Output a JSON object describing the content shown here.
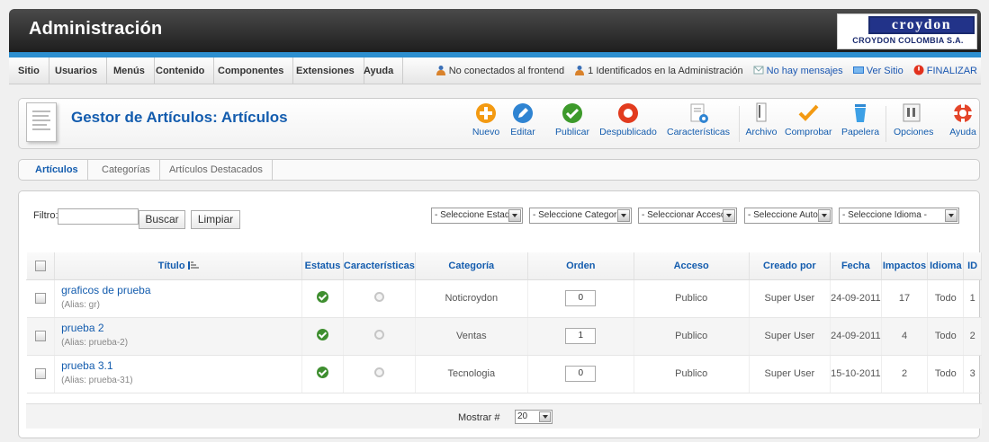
{
  "header": {
    "title": "Administración",
    "logo_main": "croydon",
    "logo_sub": "CROYDON COLOMBIA S.A."
  },
  "menu": [
    "Sitio",
    "Usuarios",
    "Menús",
    "Contenido",
    "Componentes",
    "Extensiones",
    "Ayuda"
  ],
  "status": {
    "frontend": "No conectados al frontend",
    "admin": "1 Identificados en la Administración",
    "messages": "No hay mensajes",
    "view_site": "Ver Sitio",
    "logout": "FINALIZAR"
  },
  "toolbar": {
    "title": "Gestor de Artículos: Artículos",
    "buttons": [
      "Nuevo",
      "Editar",
      "Publicar",
      "Despublicado",
      "Características",
      "Archivo",
      "Comprobar",
      "Papelera",
      "Opciones",
      "Ayuda"
    ]
  },
  "tabs": [
    "Artículos",
    "Categorías",
    "Artículos Destacados"
  ],
  "filter": {
    "label": "Filtro:",
    "value": "",
    "search_button": "Buscar",
    "clear_button": "Limpiar",
    "selects": [
      "- Seleccione Estado -",
      "- Seleccione Categoría -",
      "- Seleccionar Acceso -",
      "- Seleccione Autor -",
      "- Seleccione Idioma -"
    ]
  },
  "table": {
    "headers": [
      "Título",
      "Estatus",
      "Características",
      "Categoría",
      "Orden",
      "Acceso",
      "Creado por",
      "Fecha",
      "Impactos",
      "Idioma",
      "ID"
    ],
    "rows": [
      {
        "title": "graficos de prueba",
        "alias": "(Alias: gr)",
        "category": "Noticroydon",
        "order": "0",
        "access": "Publico",
        "author": "Super User",
        "date": "24-09-2011",
        "hits": "17",
        "language": "Todo",
        "id": "1"
      },
      {
        "title": "prueba 2",
        "alias": "(Alias: prueba-2)",
        "category": "Ventas",
        "order": "1",
        "access": "Publico",
        "author": "Super User",
        "date": "24-09-2011",
        "hits": "4",
        "language": "Todo",
        "id": "2"
      },
      {
        "title": "prueba 3.1",
        "alias": "(Alias: prueba-31)",
        "category": "Tecnologia",
        "order": "0",
        "access": "Publico",
        "author": "Super User",
        "date": "15-10-2011",
        "hits": "2",
        "language": "Todo",
        "id": "3"
      }
    ]
  },
  "pagination": {
    "label": "Mostrar #",
    "value": "20"
  }
}
